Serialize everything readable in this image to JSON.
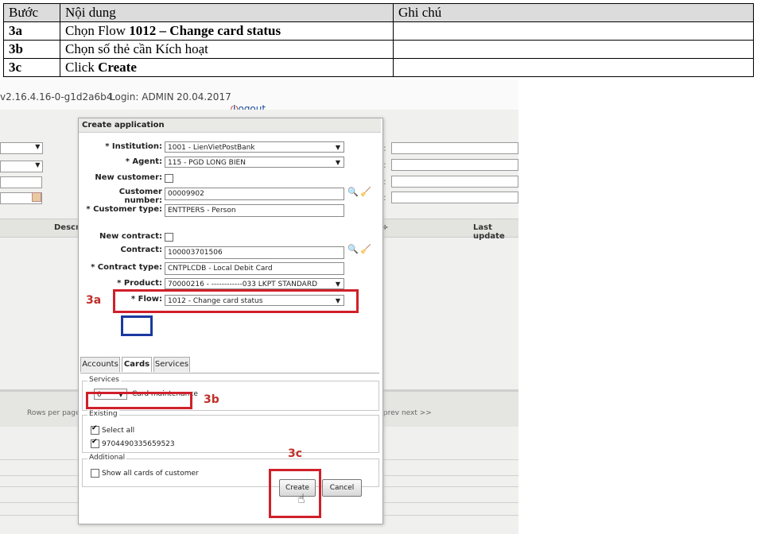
{
  "table": {
    "header": {
      "step": "Bước",
      "content": "Nội dung",
      "note": "Ghi chú"
    },
    "rows": [
      {
        "step": "3a",
        "prefix": "Chọn Flow ",
        "bold": "1012 – Change card status",
        "note": ""
      },
      {
        "step": "3b",
        "prefix": "Chọn số thẻ cần Kích hoạt",
        "bold": "",
        "note": ""
      },
      {
        "step": "3c",
        "prefix": "Click ",
        "bold": "Create",
        "note": ""
      }
    ]
  },
  "screenshot": {
    "topbar": {
      "version": "v2.16.4.16-0-g1d2a6b4",
      "login": "Login: ADMIN",
      "date": "20.04.2017",
      "logout": "Logout"
    },
    "background": {
      "col_desc": "Descri",
      "col_last_update": "Last update",
      "rows_per_page": "Rows per page",
      "pager": "prev next >>"
    },
    "dialog": {
      "title": "Create application",
      "institution_label": "* Institution:",
      "institution_value": "1001 - LienVietPostBank",
      "agent_label": "* Agent:",
      "agent_value": "115 - PGD LONG BIEN",
      "new_customer_label": "New customer:",
      "customer_number_label": "Customer number:",
      "customer_number_value": "00009902",
      "customer_type_label": "* Customer type:",
      "customer_type_value": "ENTTPERS - Person",
      "new_contract_label": "New contract:",
      "contract_label": "Contract:",
      "contract_value": "100003701506",
      "contract_type_label": "* Contract type:",
      "contract_type_value": "CNTPLCDB - Local Debit Card",
      "product_label": "* Product:",
      "product_value": "70000216 - ------------033 LKPT STANDARD",
      "flow_label": "* Flow:",
      "flow_value": "1012 - Change card status",
      "tabs": [
        "Accounts",
        "Cards",
        "Services"
      ],
      "services_group": "Services",
      "services_select_value": "0",
      "card_maintenance": "Card maintenance",
      "existing_group": "Existing",
      "select_all": "Select all",
      "card_number": "9704490335659523",
      "additional_group": "Additional",
      "show_all_cards": "Show all cards of customer",
      "create_button": "Create",
      "cancel_button": "Cancel"
    },
    "annotations": {
      "a3a": "3a",
      "a3b": "3b",
      "a3c": "3c"
    },
    "colors": {
      "annotation_red": "#d0202a",
      "annotation_blue": "#1a3aa0"
    }
  }
}
